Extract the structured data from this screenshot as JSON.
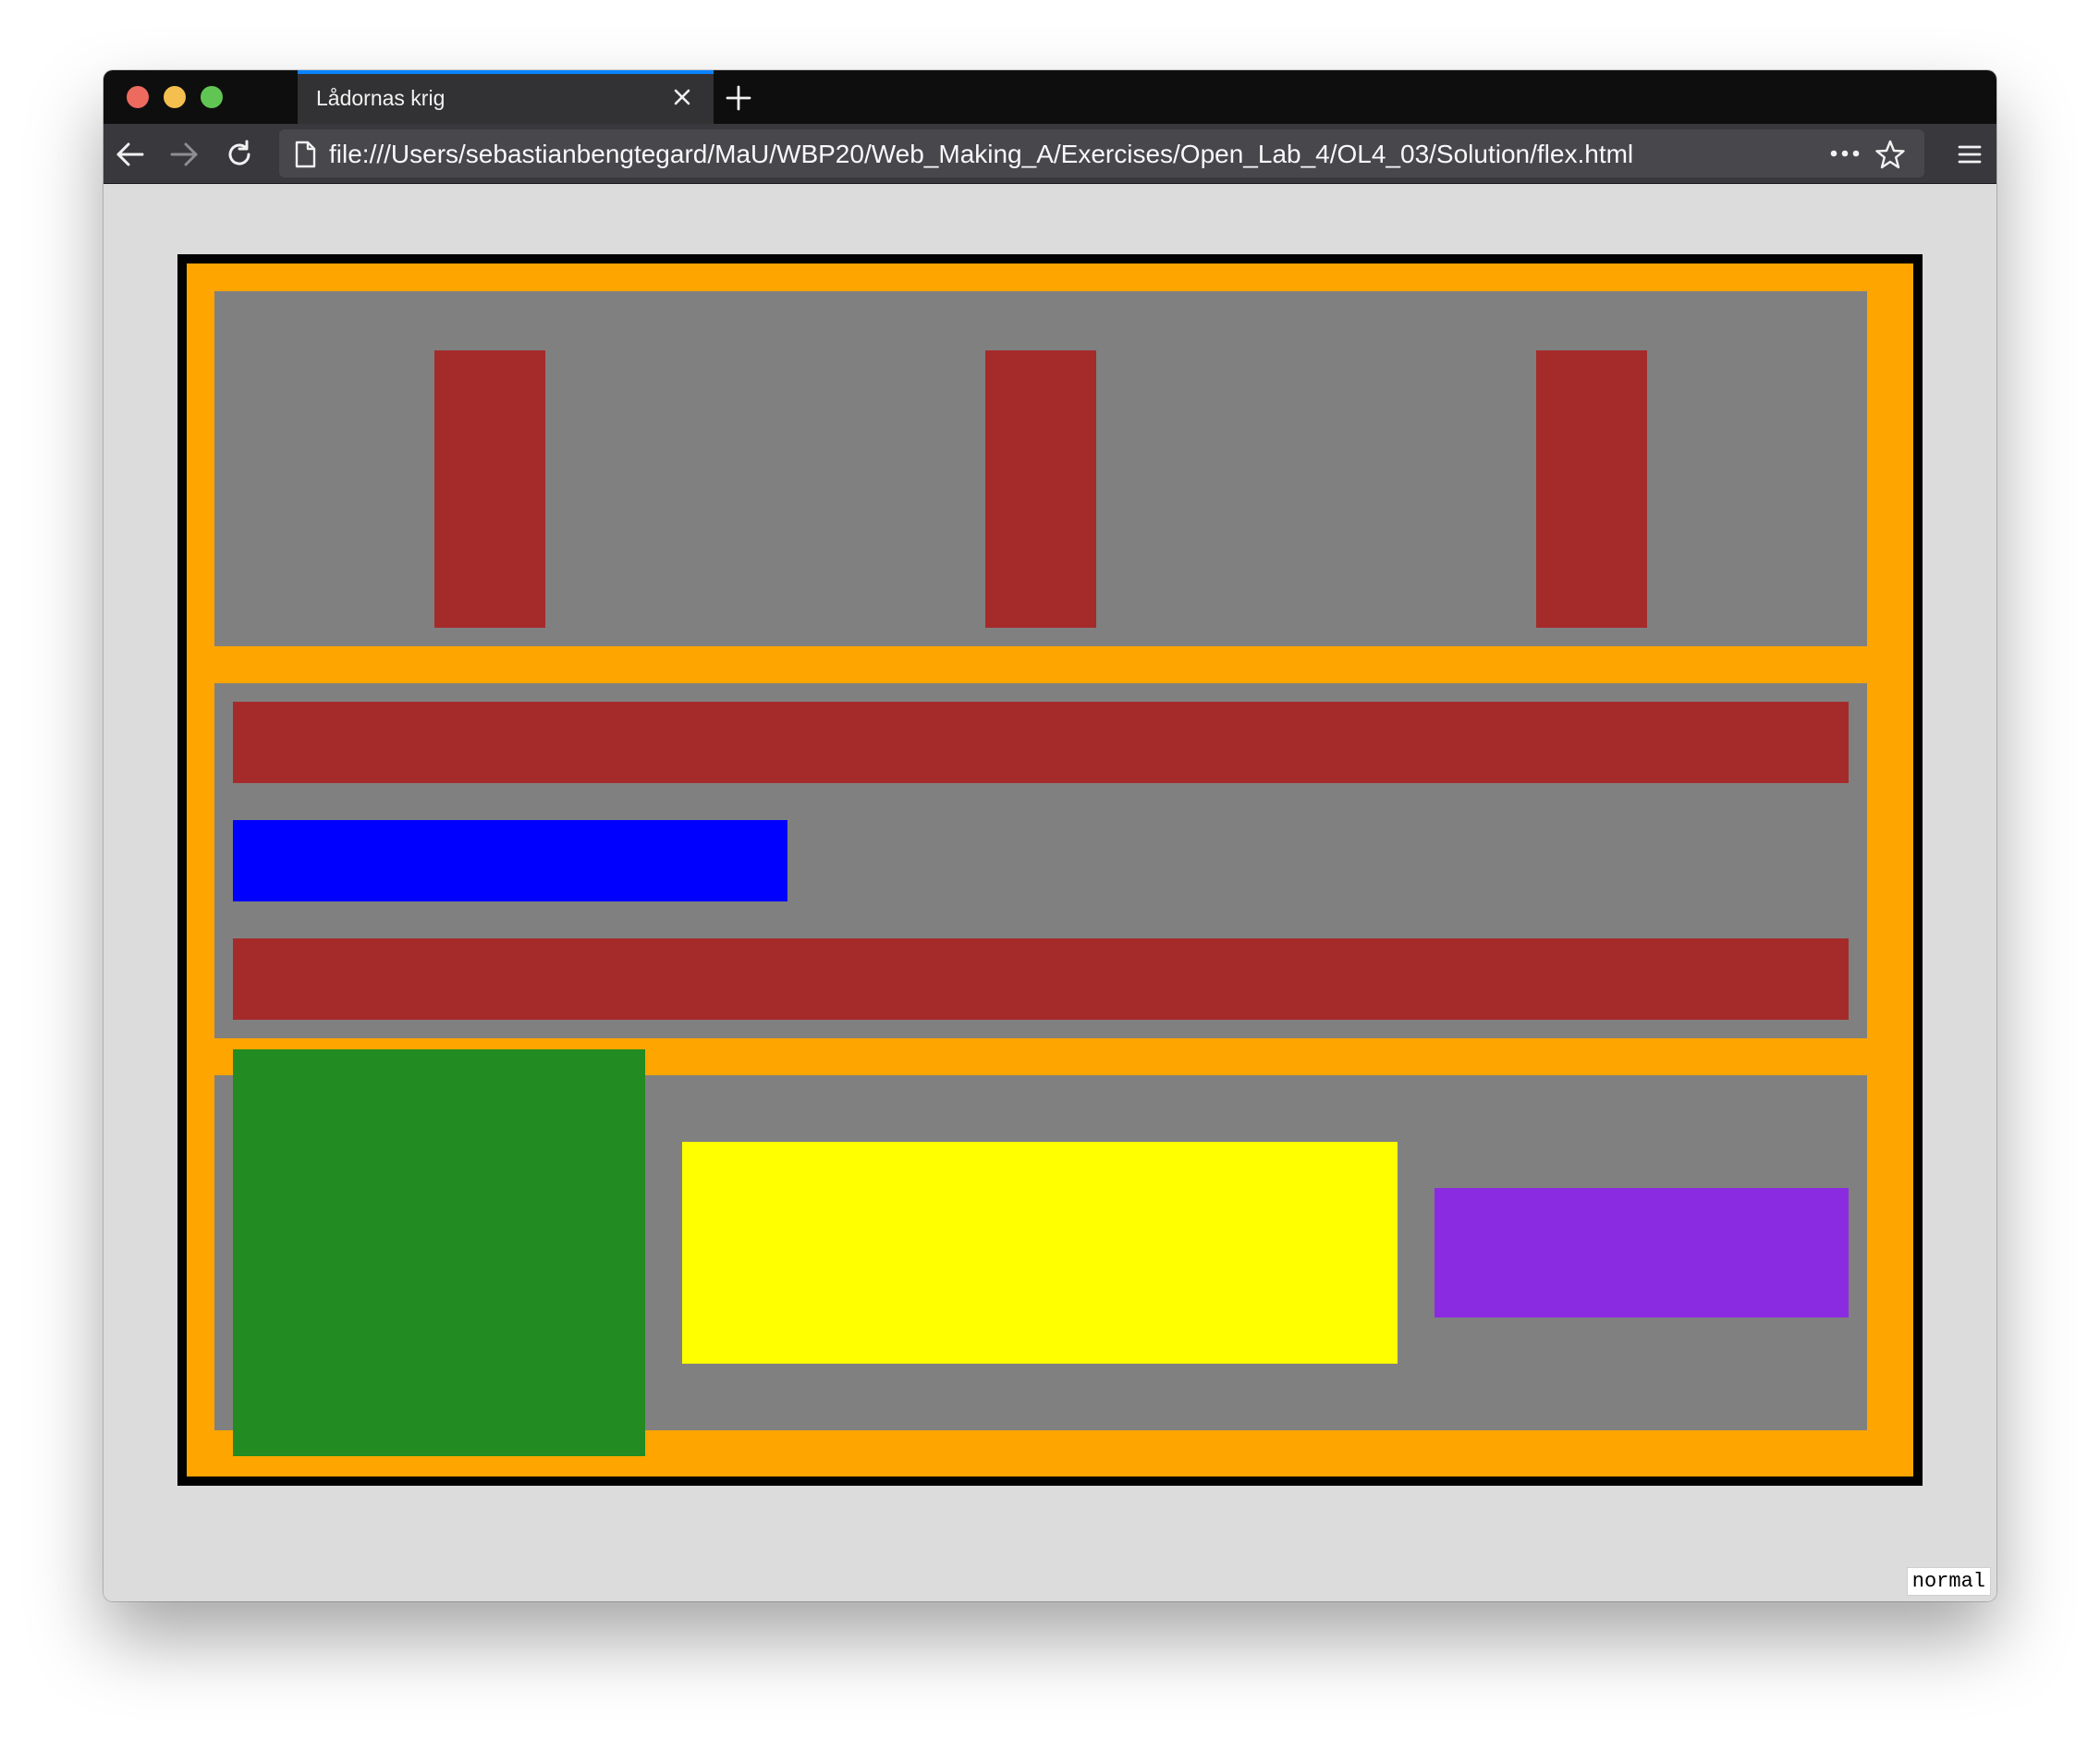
{
  "browser": {
    "tab_title": "Lådornas krig",
    "url": "file:///Users/sebastianbengtegard/MaU/WBP20/Web_Making_A/Exercises/Open_Lab_4/OL4_03/Solution/flex.html",
    "icons": {
      "close_window": "close-window-icon",
      "minimize_window": "minimize-window-icon",
      "maximize_window": "maximize-window-icon",
      "tab_close": "close-icon",
      "new_tab": "plus-icon",
      "back": "arrow-left-icon",
      "forward": "arrow-right-icon",
      "reload": "reload-icon",
      "page": "page-icon",
      "page_actions": "more-horizontal-icon",
      "bookmark": "star-icon",
      "menu": "hamburger-menu-icon"
    },
    "colors": {
      "traffic_close": "#ed6a5e",
      "traffic_min": "#f4bf4f",
      "traffic_max": "#61c554",
      "tab_accent": "#0a84ff"
    }
  },
  "page": {
    "mode_label": "normal",
    "colors": {
      "background": "#dcdcdc",
      "container_border": "#000000",
      "container": "#ffa500",
      "section": "#808080"
    },
    "sections": [
      {
        "name": "section-1",
        "boxes": [
          {
            "color": "#a52a2a"
          },
          {
            "color": "#a52a2a"
          },
          {
            "color": "#a52a2a"
          }
        ]
      },
      {
        "name": "section-2",
        "boxes": [
          {
            "color": "#a52a2a"
          },
          {
            "color": "#0000ff"
          },
          {
            "color": "#a52a2a"
          }
        ]
      },
      {
        "name": "section-3",
        "boxes": [
          {
            "color": "#228b22"
          },
          {
            "color": "#ffff00"
          },
          {
            "color": "#8a2be2"
          }
        ]
      }
    ]
  }
}
